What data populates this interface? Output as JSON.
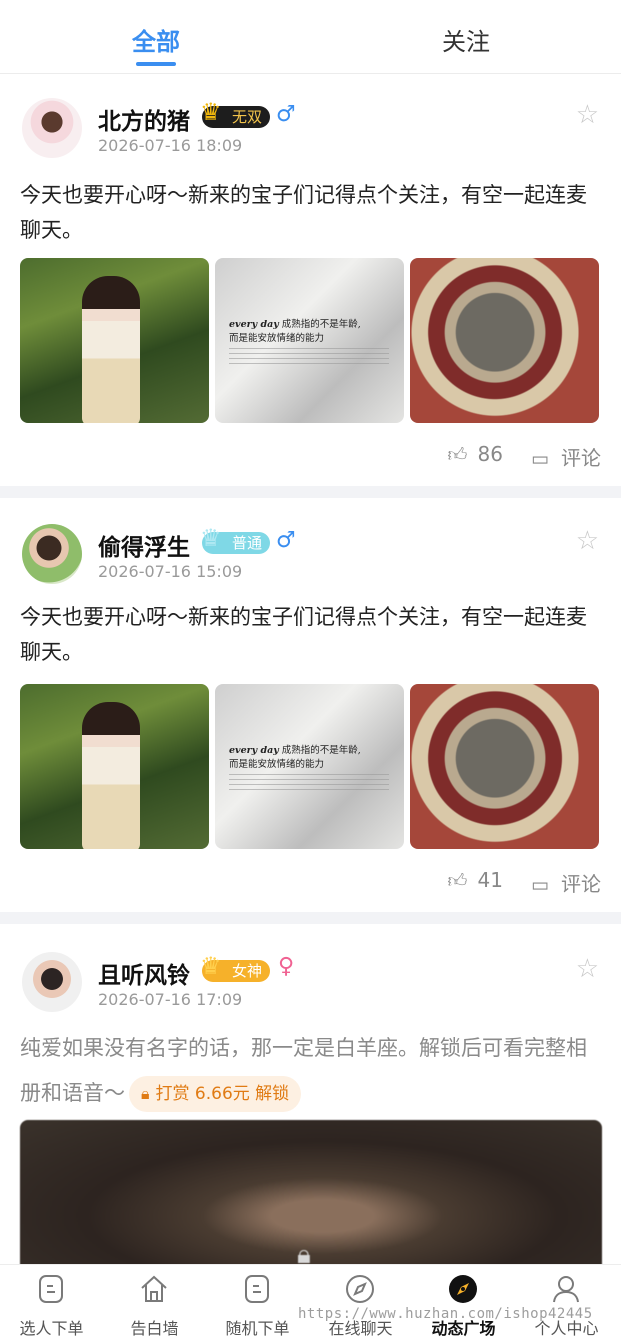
{
  "tabs": [
    {
      "label": "全部",
      "active": true
    },
    {
      "label": "关注",
      "active": false
    }
  ],
  "posts": [
    {
      "name": "北方的猪",
      "badge": "无双",
      "gender": "♂",
      "time": "2026-07-16 18:09",
      "text": "今天也要开心呀～新来的宝子们记得点个关注，有空一起连麦聊天。",
      "image_quote_en": "every day",
      "image_quote_cn": "成熟指的不是年龄,",
      "image_quote_cn2": "而是能安放情绪的能力",
      "likes": "86",
      "comment_label": "评论"
    },
    {
      "name": "偷得浮生",
      "badge": "普通",
      "gender": "♂",
      "time": "2026-07-16 15:09",
      "text": "今天也要开心呀～新来的宝子们记得点个关注，有空一起连麦聊天。",
      "image_quote_en": "every day",
      "image_quote_cn": "成熟指的不是年龄,",
      "image_quote_cn2": "而是能安放情绪的能力",
      "likes": "41",
      "comment_label": "评论"
    },
    {
      "name": "且听风铃",
      "badge": "女神",
      "gender": "♀",
      "time": "2026-07-16 17:09",
      "text": "纯爱如果没有名字的话，那一定是白羊座。解锁后可看完整相册和语音～",
      "unlock_label": "打赏 6.66元 解锁"
    }
  ],
  "tabbar": [
    {
      "label": "选人下单",
      "icon": "order-icon"
    },
    {
      "label": "告白墙",
      "icon": "home-icon"
    },
    {
      "label": "随机下单",
      "icon": "random-order-icon"
    },
    {
      "label": "在线聊天",
      "icon": "compass-icon"
    },
    {
      "label": "动态广场",
      "icon": "compass-active-icon",
      "active": true
    },
    {
      "label": "个人中心",
      "icon": "user-icon"
    }
  ],
  "watermark": "https://www.huzhan.com/ishop42445",
  "colors": {
    "accent": "#3a8ef0",
    "unlock": "#e07b14",
    "separator": "#f2f3f6"
  }
}
